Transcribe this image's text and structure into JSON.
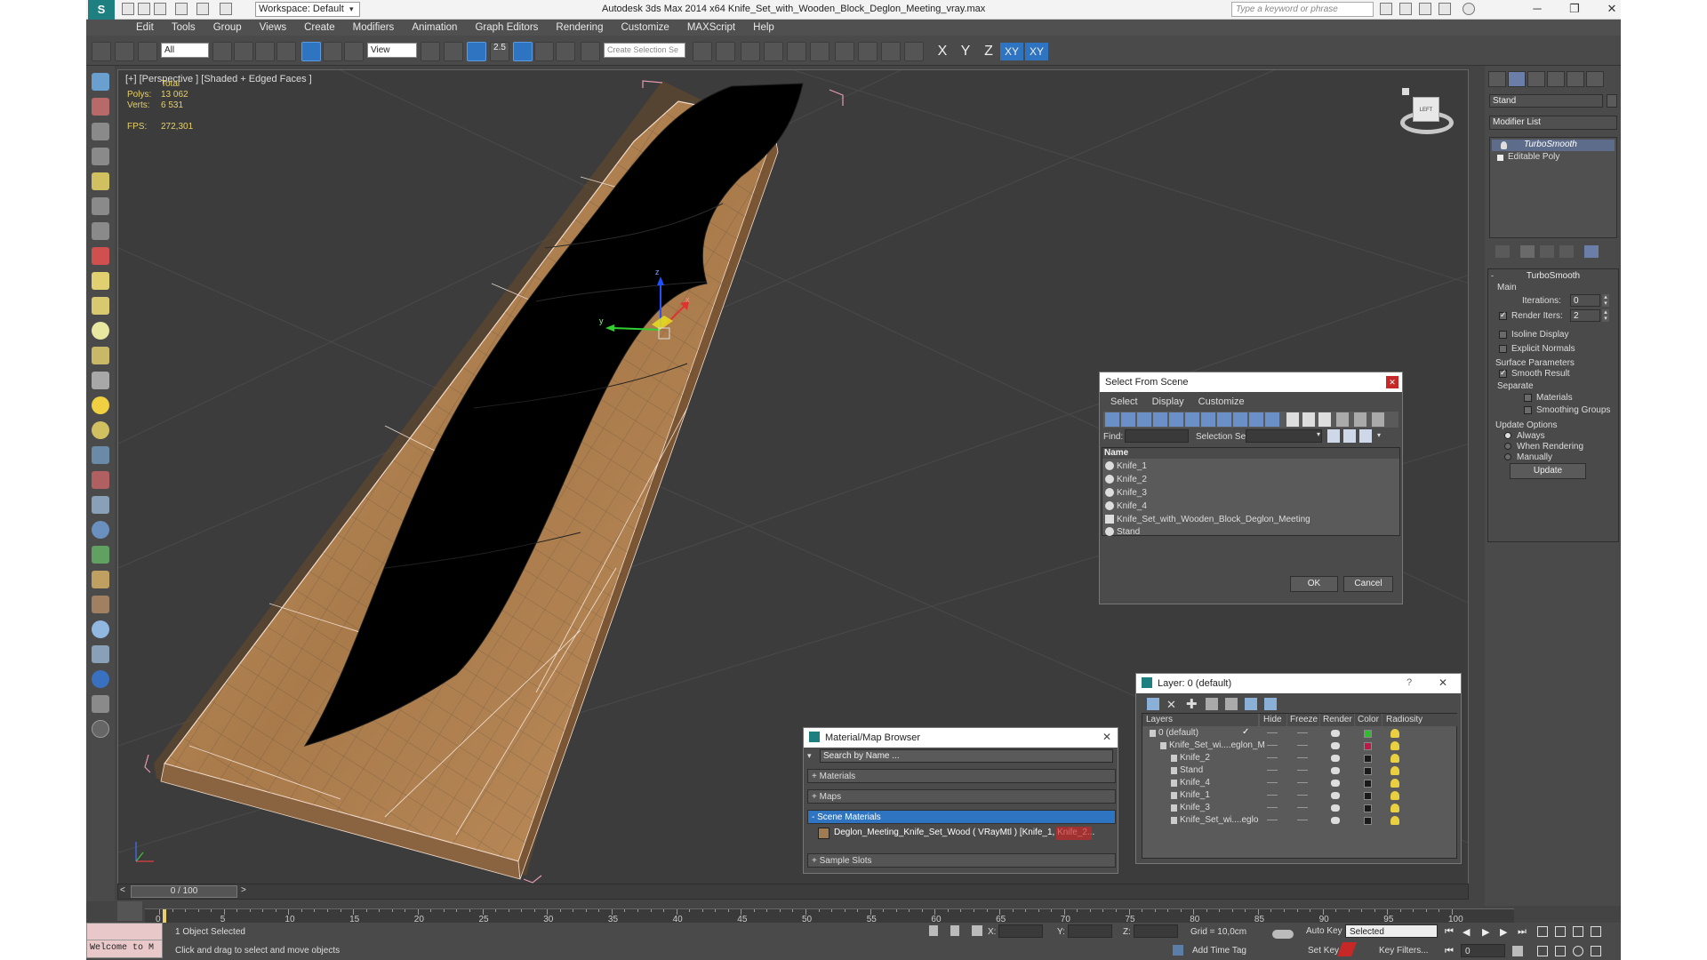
{
  "title_bar": {
    "app_title": "Autodesk 3ds Max  2014 x64    Knife_Set_with_Wooden_Block_Deglon_Meeting_vray.max",
    "workspace": "Workspace: Default",
    "search_placeholder": "Type a keyword or phrase"
  },
  "menu": [
    "Edit",
    "Tools",
    "Group",
    "Views",
    "Create",
    "Modifiers",
    "Animation",
    "Graph Editors",
    "Rendering",
    "Customize",
    "MAXScript",
    "Help"
  ],
  "toolbar": {
    "selection_filter": "All",
    "ref_coord": "View",
    "snap_label": "2.5",
    "named_selection": "Create Selection Se",
    "axes": [
      "X",
      "Y",
      "Z",
      "XY",
      "XY"
    ]
  },
  "viewport": {
    "label": "[+] [Perspective ] [Shaded + Edged Faces ]",
    "stats": {
      "total_label": "Total",
      "polys_label": "Polys:",
      "polys": "13 062",
      "verts_label": "Verts:",
      "verts": "6 531",
      "fps_label": "FPS:",
      "fps": "272,301"
    },
    "viewcube_label": "LEFT",
    "gizmo_axes": {
      "x": "x",
      "y": "y",
      "z": "z"
    }
  },
  "command_panel": {
    "object_name": "Stand",
    "modifier_list": "Modifier List",
    "stack": [
      "TurboSmooth",
      "Editable Poly"
    ],
    "rollout_title": "TurboSmooth",
    "main_label": "Main",
    "iterations_label": "Iterations:",
    "iterations": "0",
    "render_iters_label": "Render Iters:",
    "render_iters": "2",
    "isoline": "Isoline Display",
    "explicit": "Explicit Normals",
    "surface_params": "Surface Parameters",
    "smooth_result": "Smooth Result",
    "separate": "Separate",
    "materials": "Materials",
    "smoothing_groups": "Smoothing Groups",
    "update_options": "Update Options",
    "always": "Always",
    "when_rendering": "When Rendering",
    "manually": "Manually",
    "update_btn": "Update"
  },
  "select_from_scene": {
    "title": "Select From Scene",
    "menus": [
      "Select",
      "Display",
      "Customize"
    ],
    "find_label": "Find:",
    "selection_set_label": "Selection Set:",
    "column": "Name",
    "items": [
      "Knife_1",
      "Knife_2",
      "Knife_3",
      "Knife_4",
      "Knife_Set_with_Wooden_Block_Deglon_Meeting",
      "Stand"
    ],
    "ok": "OK",
    "cancel": "Cancel"
  },
  "material_browser": {
    "title": "Material/Map Browser",
    "search_placeholder": "Search by Name ...",
    "groups": [
      "+ Materials",
      "+ Maps",
      "- Scene Materials"
    ],
    "material_item": "Deglon_Meeting_Knife_Set_Wood  ( VRayMtl )  [Knife_1, Knife_2...",
    "sample_slots": "+ Sample Slots"
  },
  "layer_dialog": {
    "title": "Layer: 0 (default)",
    "help": "?",
    "columns": [
      "Layers",
      "Hide",
      "Freeze",
      "Render",
      "Color",
      "Radiosity"
    ],
    "rows": [
      {
        "name": "0 (default)",
        "indent": 0,
        "color": "#2dbd2d"
      },
      {
        "name": "Knife_Set_wi....eglon_M",
        "indent": 1,
        "color": "#c0184a"
      },
      {
        "name": "Knife_2",
        "indent": 2,
        "color": "#1a1a1a"
      },
      {
        "name": "Stand",
        "indent": 2,
        "color": "#1a1a1a"
      },
      {
        "name": "Knife_4",
        "indent": 2,
        "color": "#1a1a1a"
      },
      {
        "name": "Knife_1",
        "indent": 2,
        "color": "#1a1a1a"
      },
      {
        "name": "Knife_3",
        "indent": 2,
        "color": "#1a1a1a"
      },
      {
        "name": "Knife_Set_wi....eglo",
        "indent": 2,
        "color": "#1a1a1a"
      }
    ]
  },
  "timeline": {
    "frame": "0 / 100",
    "ticks": [
      "0",
      "5",
      "10",
      "15",
      "20",
      "25",
      "30",
      "35",
      "40",
      "45",
      "50",
      "55",
      "60",
      "65",
      "70",
      "75",
      "80",
      "85",
      "90",
      "95",
      "100"
    ]
  },
  "status": {
    "maxscript": "Welcome to M",
    "selected": "1 Object Selected",
    "prompt": "Click and drag to select and move objects",
    "x_label": "X:",
    "y_label": "Y:",
    "z_label": "Z:",
    "grid": "Grid = 10,0cm",
    "add_time_tag": "Add Time Tag",
    "auto_key": "Auto Key",
    "selected_dropdown": "Selected",
    "set_key": "Set Key",
    "key_filters": "Key Filters...",
    "frame_field": "0"
  }
}
